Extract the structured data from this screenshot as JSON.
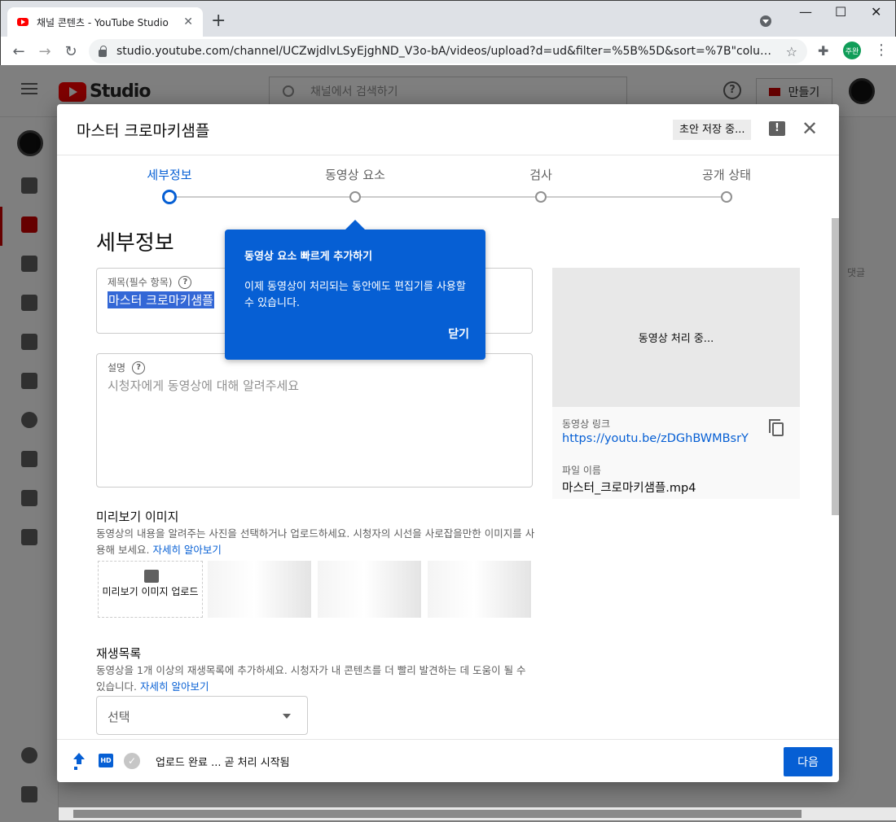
{
  "browser": {
    "tab_title": "채널 콘텐츠 - YouTube Studio",
    "url": "studio.youtube.com/channel/UCZwjdlvLSyEjghND_V3o-bA/videos/upload?d=ud&filter=%5B%5D&sort=%7B\"columnType\"%3...",
    "profile_label": "주완"
  },
  "studio": {
    "logo_text": "Studio",
    "search_placeholder": "채널에서 검색하기",
    "create_label": "만들기",
    "bg_column": "댓글"
  },
  "dialog": {
    "title": "마스터 크로마키샘플",
    "draft_status": "초안 저장 중...",
    "steps": [
      "세부정보",
      "동영상 요소",
      "검사",
      "공개 상태"
    ],
    "active_step": 0,
    "section_title": "세부정보",
    "title_field": {
      "label": "제목(필수 항목)",
      "value": "마스터 크로마키샘플"
    },
    "description_field": {
      "label": "설명",
      "placeholder": "시청자에게 동영상에 대해 알려주세요"
    },
    "thumbnail": {
      "heading": "미리보기 이미지",
      "description": "동영상의 내용을 알려주는 사진을 선택하거나 업로드하세요. 시청자의 시선을 사로잡을만한 이미지를 사용해 보세요.",
      "learn_more": "자세히 알아보기",
      "upload_label": "미리보기 이미지 업로드"
    },
    "playlist": {
      "heading": "재생목록",
      "description": "동영상을 1개 이상의 재생목록에 추가하세요. 시청자가 내 콘텐츠를 더 빨리 발견하는 데 도움이 될 수 있습니다.",
      "learn_more": "자세히 알아보기",
      "select_placeholder": "선택"
    },
    "preview": {
      "processing": "동영상 처리 중...",
      "link_label": "동영상 링크",
      "link": "https://youtu.be/zDGhBWMBsrY",
      "filename_label": "파일 이름",
      "filename": "마스터_크로마키샘플.mp4"
    },
    "footer": {
      "status": "업로드 완료 ... 곧 처리 시작됨",
      "hd_badge": "HD",
      "next_label": "다음"
    }
  },
  "tooltip": {
    "title": "동영상 요소 빠르게 추가하기",
    "body": "이제 동영상이 처리되는 동안에도 편집기를 사용할 수 있습니다.",
    "close_label": "닫기"
  },
  "colors": {
    "accent": "#065fd4",
    "brand_red": "#ff0000"
  }
}
